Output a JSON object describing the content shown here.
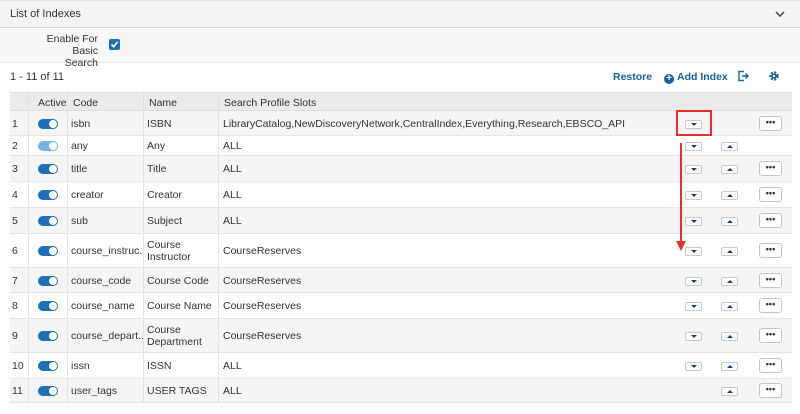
{
  "section": {
    "title": "List of Indexes"
  },
  "basic_search": {
    "label_line1": "Enable For Basic",
    "label_line2": "Search",
    "checked": true
  },
  "toolbar": {
    "count": "1 - 11 of 11",
    "restore": "Restore",
    "add_index": "Add Index"
  },
  "columns": {
    "active": "Active",
    "code": "Code",
    "name": "Name",
    "slots": "Search Profile Slots"
  },
  "rows": [
    {
      "num": "1",
      "code": "isbn",
      "name": "ISBN",
      "name2": "",
      "slots": "LibraryCatalog,NewDiscoveryNetwork,CentralIndex,Everything,Research,EBSCO_API",
      "active": true,
      "light": false,
      "down": true,
      "up": false
    },
    {
      "num": "2",
      "code": "any",
      "name": "Any",
      "name2": "",
      "slots": "ALL",
      "active": true,
      "light": true,
      "down": true,
      "up": true
    },
    {
      "num": "3",
      "code": "title",
      "name": "Title",
      "name2": "",
      "slots": "ALL",
      "active": true,
      "light": false,
      "down": true,
      "up": true
    },
    {
      "num": "4",
      "code": "creator",
      "name": "Creator",
      "name2": "",
      "slots": "ALL",
      "active": true,
      "light": false,
      "down": true,
      "up": true
    },
    {
      "num": "5",
      "code": "sub",
      "name": "Subject",
      "name2": "",
      "slots": "ALL",
      "active": true,
      "light": false,
      "down": true,
      "up": true
    },
    {
      "num": "6",
      "code": "course_instruc...",
      "name": "Course",
      "name2": "Instructor",
      "slots": "CourseReserves",
      "active": true,
      "light": false,
      "down": true,
      "up": true
    },
    {
      "num": "7",
      "code": "course_code",
      "name": "Course Code",
      "name2": "",
      "slots": "CourseReserves",
      "active": true,
      "light": false,
      "down": true,
      "up": true
    },
    {
      "num": "8",
      "code": "course_name",
      "name": "Course Name",
      "name2": "",
      "slots": "CourseReserves",
      "active": true,
      "light": false,
      "down": true,
      "up": true
    },
    {
      "num": "9",
      "code": "course_depart...",
      "name": "Course",
      "name2": "Department",
      "slots": "CourseReserves",
      "active": true,
      "light": false,
      "down": true,
      "up": true
    },
    {
      "num": "10",
      "code": "issn",
      "name": "ISSN",
      "name2": "",
      "slots": "ALL",
      "active": true,
      "light": false,
      "down": true,
      "up": true
    },
    {
      "num": "11",
      "code": "user_tags",
      "name": "USER TAGS",
      "name2": "",
      "slots": "ALL",
      "active": true,
      "light": false,
      "down": false,
      "up": true
    }
  ],
  "more_label": "•••",
  "colors": {
    "accent": "#1f6fb5",
    "link": "#1a5f9e",
    "annotation": "#e53030"
  }
}
